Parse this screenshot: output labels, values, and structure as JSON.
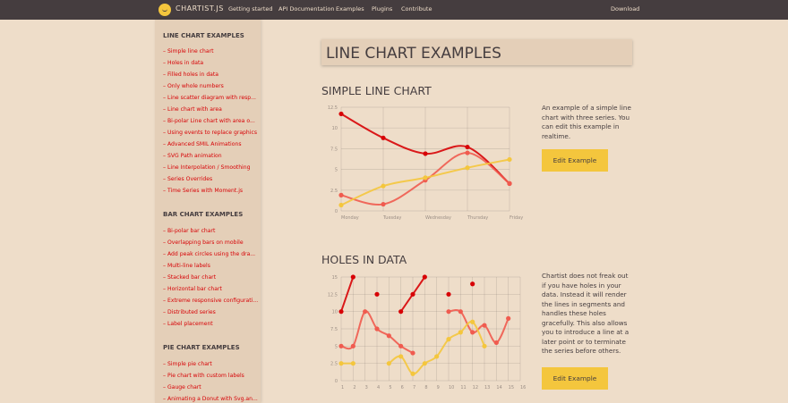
{
  "colors": {
    "background": "#eeddc9",
    "nav": "#453d3f",
    "accent_red": "#d70206",
    "accent_yellow": "#f4c63d",
    "series_orange": "#f05b4f"
  },
  "topnav": {
    "brand": "CHARTIST.JS",
    "links": [
      "Getting started",
      "API Documentation",
      "Examples",
      "Plugins",
      "Contribute"
    ],
    "download": "Download"
  },
  "sidebar": {
    "groups": [
      {
        "title": "LINE CHART EXAMPLES",
        "items": [
          "Simple line chart",
          "Holes in data",
          "Filled holes in data",
          "Only whole numbers",
          "Line scatter diagram with resp...",
          "Line chart with area",
          "Bi-polar Line chart with area o...",
          "Using events to replace graphics",
          "Advanced SMIL Animations",
          "SVG Path animation",
          "Line Interpolation / Smoothing",
          "Series Overrides",
          "Time Series with Moment.js"
        ]
      },
      {
        "title": "BAR CHART EXAMPLES",
        "items": [
          "Bi-polar bar chart",
          "Overlapping bars on mobile",
          "Add peak circles using the dra...",
          "Multi-line labels",
          "Stacked bar chart",
          "Horizontal bar chart",
          "Extreme responsive configurati...",
          "Distributed series",
          "Label placement"
        ]
      },
      {
        "title": "PIE CHART EXAMPLES",
        "items": [
          "Simple pie chart",
          "Pie chart with custom labels",
          "Gauge chart",
          "Animating a Donut with Svg.an..."
        ]
      }
    ]
  },
  "main": {
    "page_title": "LINE CHART EXAMPLES",
    "sections": [
      {
        "title": "SIMPLE LINE CHART",
        "description": "An example of a simple line chart with three series. You can edit this example in realtime.",
        "button": "Edit Example"
      },
      {
        "title": "HOLES IN DATA",
        "description": "Chartist does not freak out if you have holes in your data. Instead it will render the lines in segments and handles these holes gracefully. This also allows you to introduce a line at a later point or to terminate the series before others.",
        "button": "Edit Example"
      }
    ]
  },
  "chart_data": [
    {
      "type": "line",
      "categories": [
        "Monday",
        "Tuesday",
        "Wednesday",
        "Thursday",
        "Friday"
      ],
      "ylim": [
        0,
        12.5
      ],
      "yticks": [
        "0",
        "2.5",
        "5",
        "7.5",
        "10",
        "12.5"
      ],
      "grid": true,
      "series": [
        {
          "values": [
            11.7,
            8.8,
            6.9,
            7.7,
            3.3
          ],
          "color": "#d70206"
        },
        {
          "values": [
            1.9,
            0.8,
            3.7,
            7.0,
            3.3
          ],
          "color": "#f05b4f"
        },
        {
          "values": [
            0.7,
            3.0,
            4.0,
            5.2,
            6.2
          ],
          "color": "#f4c63d"
        }
      ]
    },
    {
      "type": "line",
      "categories": [
        "1",
        "2",
        "3",
        "4",
        "5",
        "6",
        "7",
        "8",
        "9",
        "10",
        "11",
        "12",
        "13",
        "14",
        "15",
        "16"
      ],
      "ylim": [
        0,
        15
      ],
      "yticks": [
        "0",
        "2.5",
        "5",
        "7.5",
        "10",
        "12.5",
        "15"
      ],
      "grid": true,
      "series": [
        {
          "values": [
            10,
            15,
            null,
            12.5,
            null,
            10,
            12.5,
            15,
            null,
            12.5,
            null,
            14,
            null,
            null,
            null,
            null
          ],
          "color": "#d70206"
        },
        {
          "values": [
            5,
            5,
            10,
            7.5,
            6.5,
            5,
            4,
            null,
            null,
            10,
            10,
            7,
            8,
            5.5,
            9,
            null
          ],
          "color": "#f05b4f"
        },
        {
          "values": [
            2.5,
            2.5,
            null,
            null,
            2.5,
            3.5,
            1,
            2.5,
            3.5,
            6,
            7,
            8.5,
            5,
            null,
            null,
            null
          ],
          "color": "#f4c63d"
        }
      ]
    }
  ]
}
